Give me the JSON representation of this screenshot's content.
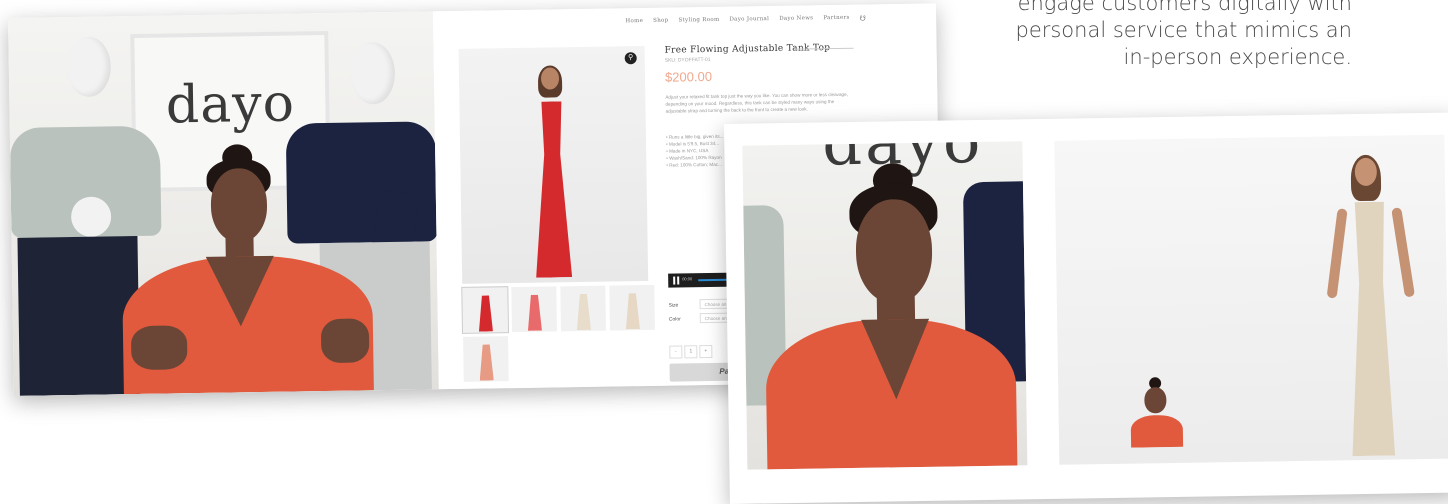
{
  "headline": {
    "lines": [
      "engage customers digitally with",
      "personal service that mimics an",
      "in-person experience."
    ]
  },
  "left_card": {
    "video": {
      "logo_text": "dayo"
    },
    "website": {
      "nav": [
        "Home",
        "Shop",
        "Styling Room",
        "Dayo Journal",
        "Dayo News",
        "Partners"
      ],
      "product": {
        "title": "Free Flowing Adjustable Tank Top",
        "sku": "SKU: DYOFFATT-01",
        "price": "$200.00",
        "description": "Adjust your relaxed fit tank top just the way you like. You can show more or less cleavage, depending on your mood. Regardless, this tank can be styled many ways using the adjustable strap and turning the back to the front to create a new look.",
        "bullets": [
          "• Runs a little big, given its...",
          "• Model is 5'9.5, Bust 34...",
          "• Made in NYC, USA",
          "• Wash/Sand: 100% Rayon",
          "• Red: 100% Cotton; Mac..."
        ],
        "size_label": "Size",
        "size_placeholder": "Choose an...",
        "color_label": "Color",
        "color_placeholder": "Choose an...",
        "qty_minus": "-",
        "qty_value": "1",
        "qty_plus": "+",
        "paypal_label": "PayPal",
        "player_time": "00:00"
      },
      "thumbnail_colors": [
        "#d42a2e",
        "#e86a6a",
        "#e8dccb",
        "#e6d8c4",
        "#e79a84"
      ]
    }
  },
  "right_card": {
    "video_left": {
      "logo_text": "dayo"
    }
  }
}
